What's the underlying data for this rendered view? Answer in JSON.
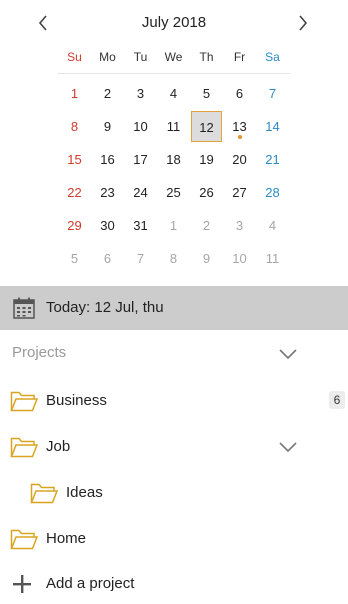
{
  "calendar": {
    "month_title": "July 2018",
    "weekdays": [
      "Su",
      "Mo",
      "Tu",
      "We",
      "Th",
      "Fr",
      "Sa"
    ],
    "weeks": [
      [
        "1",
        "2",
        "3",
        "4",
        "5",
        "6",
        "7"
      ],
      [
        "8",
        "9",
        "10",
        "11",
        "12",
        "13",
        "14"
      ],
      [
        "15",
        "16",
        "17",
        "18",
        "19",
        "20",
        "21"
      ],
      [
        "22",
        "23",
        "24",
        "25",
        "26",
        "27",
        "28"
      ],
      [
        "29",
        "30",
        "31",
        "1",
        "2",
        "3",
        "4"
      ],
      [
        "5",
        "6",
        "7",
        "8",
        "9",
        "10",
        "11"
      ]
    ],
    "today_label": "Today: 12 Jul, thu",
    "colors": {
      "sunday": "#d23b2b",
      "saturday": "#2a8bc5",
      "other_month": "#a6a6a6",
      "today_border": "#e2a13b",
      "event_dot": "#e8932c"
    }
  },
  "projects": {
    "section_title": "Projects",
    "items": [
      {
        "label": "Business",
        "badge": "6"
      },
      {
        "label": "Job"
      },
      {
        "label": "Ideas"
      },
      {
        "label": "Home"
      }
    ],
    "add_label": "Add a project",
    "folder_color": "#d9a520"
  }
}
